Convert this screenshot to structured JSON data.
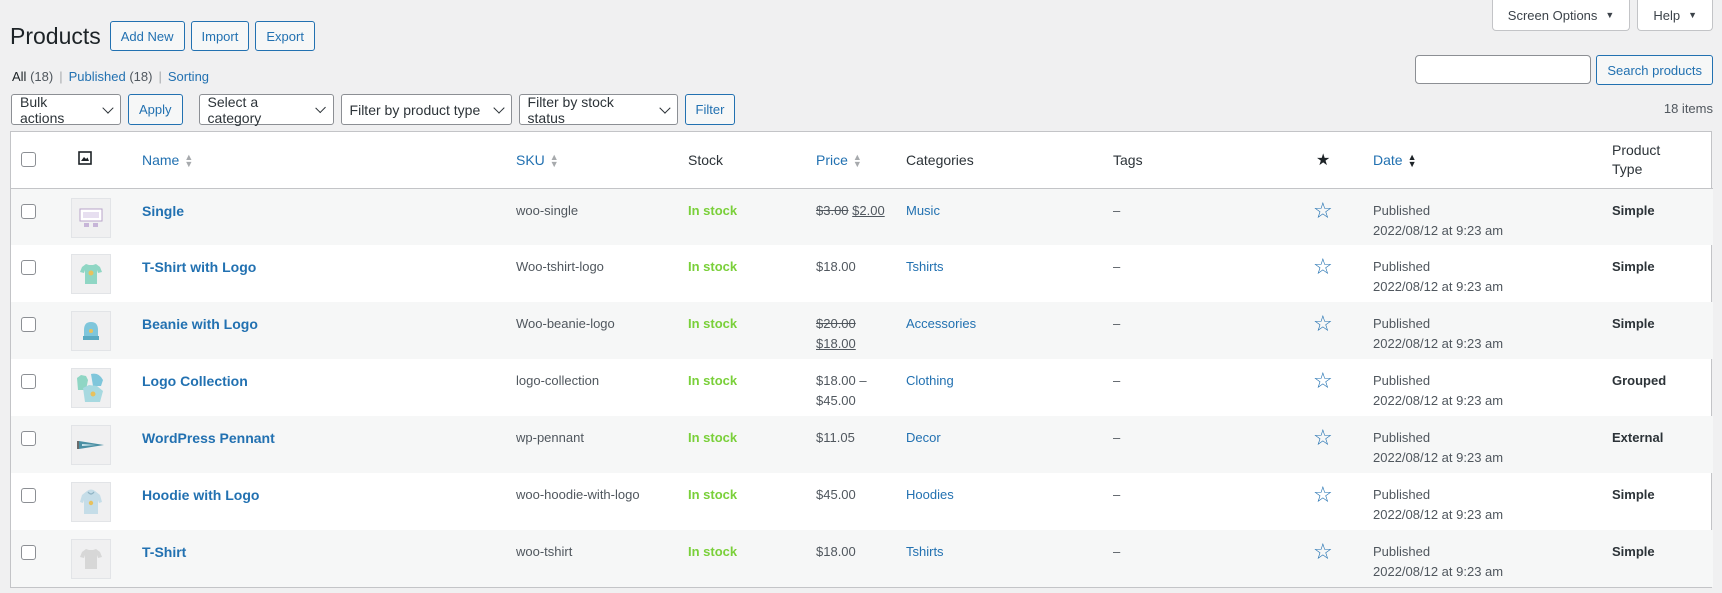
{
  "topbar": {
    "screen_options": "Screen Options",
    "help": "Help"
  },
  "header": {
    "title": "Products",
    "add_new": "Add New",
    "import": "Import",
    "export": "Export"
  },
  "views": {
    "all_label": "All",
    "all_count": "(18)",
    "published_label": "Published",
    "published_count": "(18)",
    "sorting": "Sorting"
  },
  "search": {
    "button": "Search products",
    "value": ""
  },
  "filters": {
    "bulk_actions": "Bulk actions",
    "apply": "Apply",
    "category": "Select a category",
    "product_type": "Filter by product type",
    "stock_status": "Filter by stock status",
    "filter": "Filter"
  },
  "items_count": "18 items",
  "columns": {
    "name": "Name",
    "sku": "SKU",
    "stock": "Stock",
    "price": "Price",
    "categories": "Categories",
    "tags": "Tags",
    "date": "Date",
    "product_type_1": "Product",
    "product_type_2": "Type"
  },
  "colors": {
    "accent": "#2271b1",
    "instock": "#7ad03a",
    "row_alt": "#f6f7f7"
  },
  "rows": [
    {
      "name": "Single",
      "sku": "woo-single",
      "stock": "In stock",
      "price_old": "$3.00",
      "price_new": "$2.00",
      "price_sep": " ",
      "category": "Music",
      "tags": "–",
      "date_status": "Published",
      "date": "2022/08/12 at 9:23 am",
      "type": "Simple",
      "thumb": "album-icon"
    },
    {
      "name": "T-Shirt with Logo",
      "sku": "Woo-tshirt-logo",
      "stock": "In stock",
      "price": "$18.00",
      "category": "Tshirts",
      "tags": "–",
      "date_status": "Published",
      "date": "2022/08/12 at 9:23 am",
      "type": "Simple",
      "thumb": "tshirt-icon"
    },
    {
      "name": "Beanie with Logo",
      "sku": "Woo-beanie-logo",
      "stock": "In stock",
      "price_old": "$20.00",
      "price_new": "$18.00",
      "price_sep": "",
      "category": "Accessories",
      "tags": "–",
      "date_status": "Published",
      "date": "2022/08/12 at 9:23 am",
      "type": "Simple",
      "thumb": "beanie-icon"
    },
    {
      "name": "Logo Collection",
      "sku": "logo-collection",
      "stock": "In stock",
      "price_range_1": "$18.00 –",
      "price_range_2": "$45.00",
      "category": "Clothing",
      "tags": "–",
      "date_status": "Published",
      "date": "2022/08/12 at 9:23 am",
      "type": "Grouped",
      "thumb": "collection-icon"
    },
    {
      "name": "WordPress Pennant",
      "sku": "wp-pennant",
      "stock": "In stock",
      "price": "$11.05",
      "category": "Decor",
      "tags": "–",
      "date_status": "Published",
      "date": "2022/08/12 at 9:23 am",
      "type": "External",
      "thumb": "pennant-icon"
    },
    {
      "name": "Hoodie with Logo",
      "sku": "woo-hoodie-with-logo",
      "stock": "In stock",
      "price": "$45.00",
      "category": "Hoodies",
      "tags": "–",
      "date_status": "Published",
      "date": "2022/08/12 at 9:23 am",
      "type": "Simple",
      "thumb": "hoodie-icon"
    },
    {
      "name": "T-Shirt",
      "sku": "woo-tshirt",
      "stock": "In stock",
      "price": "$18.00",
      "category": "Tshirts",
      "tags": "–",
      "date_status": "Published",
      "date": "2022/08/12 at 9:23 am",
      "type": "Simple",
      "thumb": "tshirt-plain-icon"
    }
  ]
}
